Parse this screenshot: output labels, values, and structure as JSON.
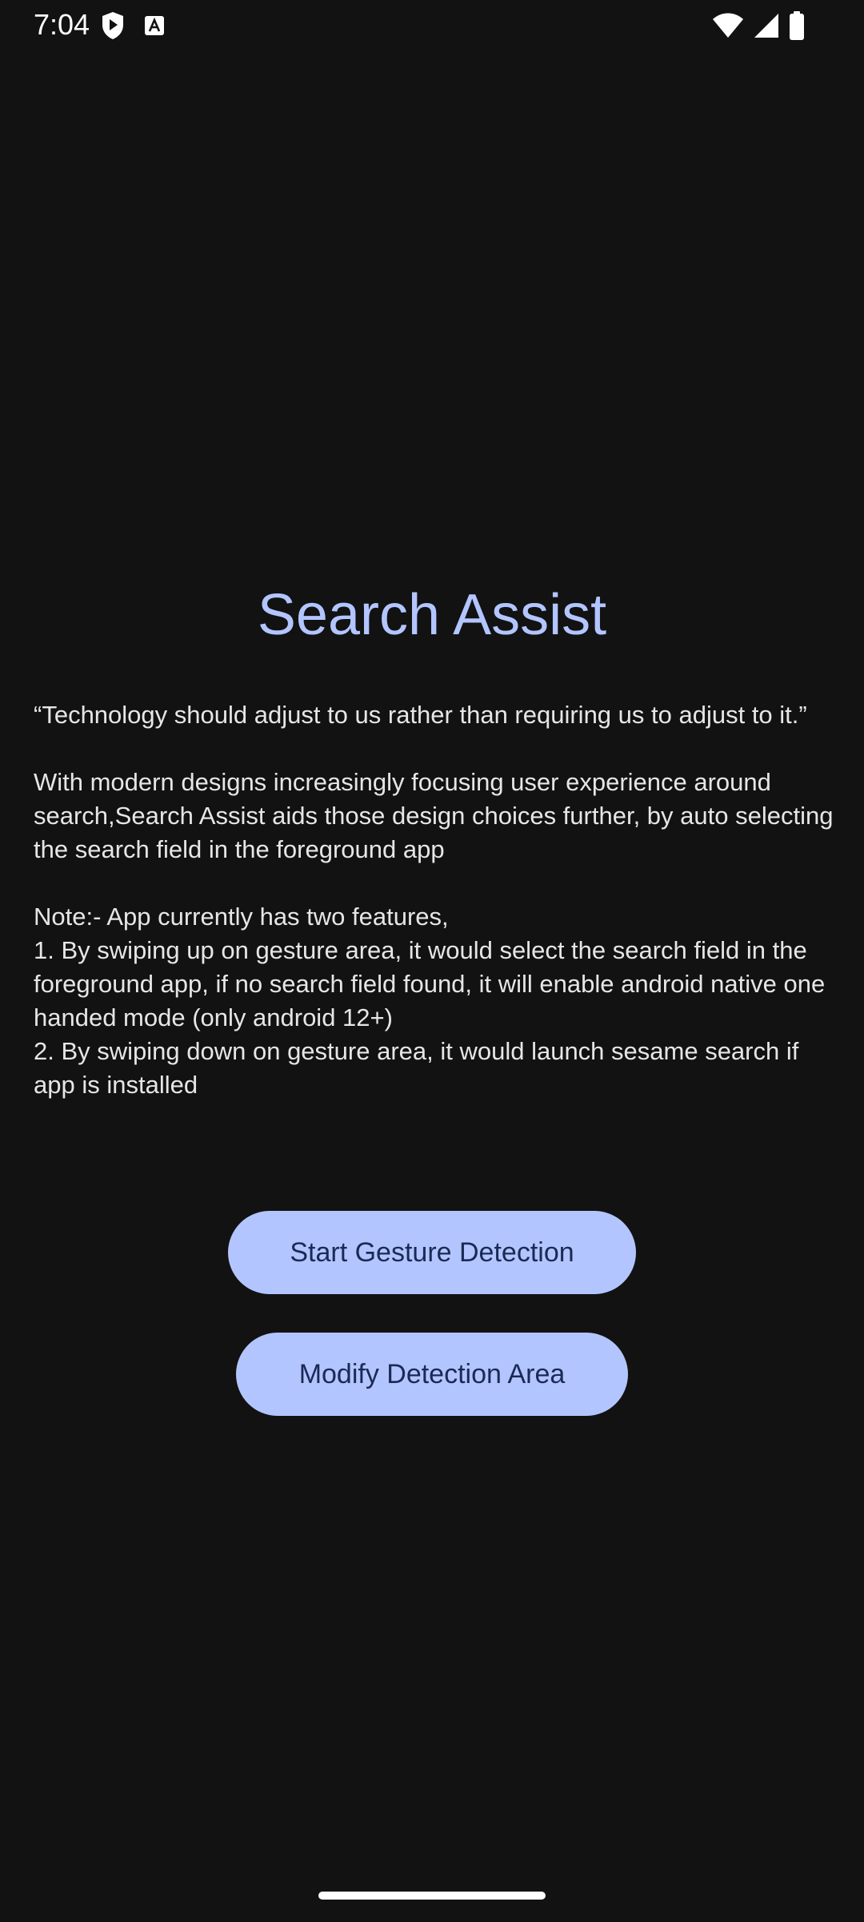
{
  "status_bar": {
    "time": "7:04",
    "left_icons": [
      "shield-play-icon",
      "text-a-icon"
    ],
    "right_icons": [
      "wifi-icon",
      "signal-icon",
      "battery-icon"
    ]
  },
  "app": {
    "title": "Search Assist",
    "quote": "“Technology should adjust to us rather than requiring us to adjust to it.”",
    "intro": "With modern designs increasingly focusing user experience around search,Search Assist aids those design choices further, by auto selecting the search field in the foreground app",
    "note_heading": "Note:- App currently has two features,",
    "feature_1": "1. By swiping up on gesture area, it would select the search field in the foreground app, if no search field found, it will enable android native one handed mode (only android 12+)",
    "feature_2": "2. By swiping down on gesture area, it would launch sesame search if app is installed"
  },
  "buttons": {
    "start_label": "Start Gesture Detection",
    "modify_label": "Modify Detection Area"
  },
  "colors": {
    "background": "#121212",
    "accent": "#b3c5ff",
    "button_text": "#1b2a55"
  }
}
